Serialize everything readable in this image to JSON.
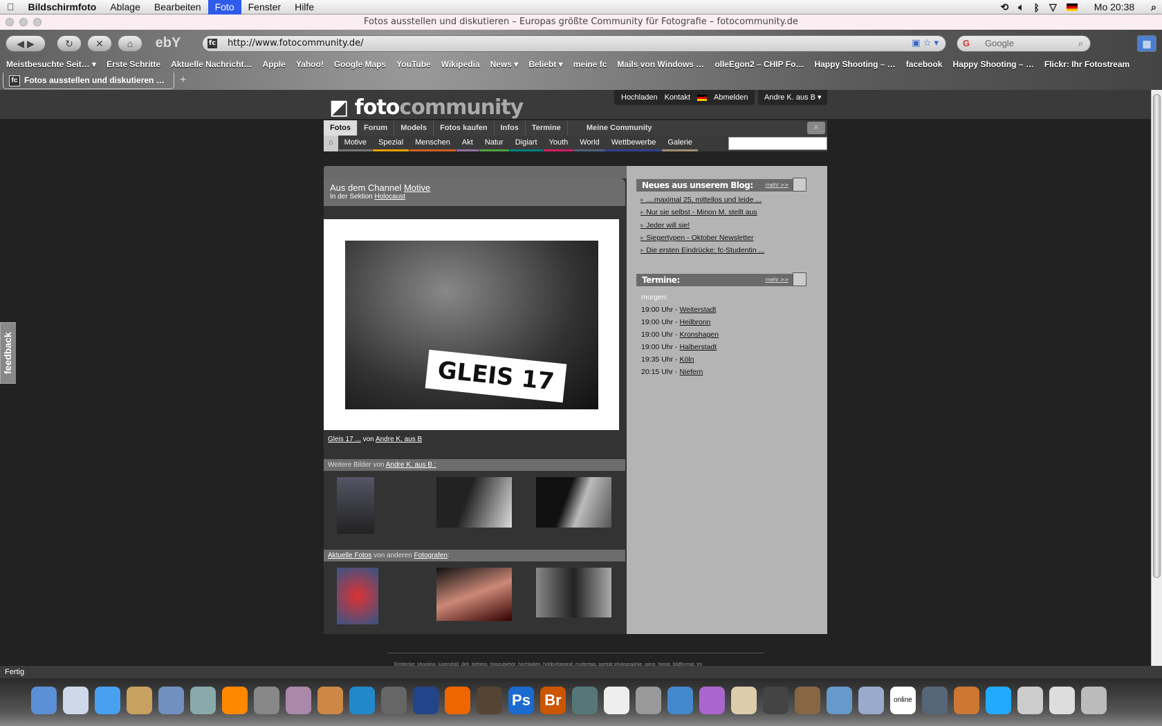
{
  "menubar": {
    "app": "Bildschirmfoto",
    "items": [
      "Ablage",
      "Bearbeiten",
      "Foto",
      "Fenster",
      "Hilfe"
    ],
    "active": "Foto",
    "clock": "Mo 20:38"
  },
  "window": {
    "title": "Fotos ausstellen und diskutieren – Europas größte Community für Fotografie – fotocommunity.de"
  },
  "toolbar": {
    "url": "http://www.fotocommunity.de/",
    "search_placeholder": "Google"
  },
  "bookmarks": [
    "Meistbesuchte Seit… ▾",
    "Erste Schritte",
    "Aktuelle Nachricht…",
    "Apple",
    "Yahoo!",
    "Google Maps",
    "YouTube",
    "Wikipedia",
    "News ▾",
    "Beliebt ▾",
    "meine fc",
    "Mails von Windows …",
    "olleEgon2 – CHIP Fo…",
    "Happy Shooting – …",
    "facebook",
    "Happy Shooting – …",
    "Flickr: Ihr Fotostream"
  ],
  "tab": {
    "label": "Fotos ausstellen und diskutieren …"
  },
  "site": {
    "logo": {
      "a": "foto",
      "b": "community"
    },
    "toplinks": [
      "Hochladen",
      "Kontakt",
      "Abmelden"
    ],
    "user": "Andre K. aus B ▾",
    "nav": [
      "Fotos",
      "Forum",
      "Models",
      "Fotos kaufen",
      "Infos",
      "Termine",
      "Meine Community"
    ],
    "subnav": [
      {
        "label": "Motive",
        "color": "#777777"
      },
      {
        "label": "Spezial",
        "color": "#e8a000"
      },
      {
        "label": "Menschen",
        "color": "#d06020"
      },
      {
        "label": "Akt",
        "color": "#9070a0"
      },
      {
        "label": "Natur",
        "color": "#50a040"
      },
      {
        "label": "Digiart",
        "color": "#008080"
      },
      {
        "label": "Youth",
        "color": "#d02060"
      },
      {
        "label": "World",
        "color": "#506080"
      },
      {
        "label": "Wettbewerbe",
        "color": "#304090"
      },
      {
        "label": "Galerie",
        "color": "#a09070"
      }
    ]
  },
  "channel": {
    "prefix": "Aus dem Channel ",
    "name": "Motive",
    "section_prefix": "In der Sektion ",
    "section": "Holocaust",
    "photo_sign": "GLEIS 17",
    "photo_title": "Gleis 17 ...",
    "von": " von ",
    "author": "Andre K. aus B"
  },
  "more": {
    "prefix": "Weitere Bilder von ",
    "author": "Andre K. aus B :"
  },
  "recent": {
    "link1": "Aktuelle Fotos",
    "mid": " von anderen ",
    "link2": "Fotografen",
    "suffix": ":"
  },
  "blog": {
    "title": "Neues aus unserem Blog:",
    "mehr": "mehr >>",
    "items": [
      "....maximal 25, mittellos und leide ...",
      "Nur sie selbst - Minon M. stellt aus",
      "Jeder will sie!",
      "Siegertypen - Oktober Newsletter",
      "Die ersten Eindrücke: fc-Studentin ..."
    ]
  },
  "termine": {
    "title": "Termine:",
    "mehr": "mehr >>",
    "day": "morgen:",
    "items": [
      {
        "time": "19:00 Uhr - ",
        "place": "Weiterstadt"
      },
      {
        "time": "19:00 Uhr - ",
        "place": "Heilbronn"
      },
      {
        "time": "19:00 Uhr - ",
        "place": "Kronshagen"
      },
      {
        "time": "19:00 Uhr - ",
        "place": "Halberstadt"
      },
      {
        "time": "19:35 Uhr - ",
        "place": "Köln"
      },
      {
        "time": "20:15 Uhr - ",
        "place": "Niefern"
      }
    ]
  },
  "feedback": "feedback",
  "footer": "Entdecke: shooting, jugendstil, delr, tiefotos, fotozubehör, hochladen, hobbyfotograf, muttertag, porträt photographie, gimp, heirat, bildformat, tm",
  "status": "Fertig",
  "dock": {
    "ps": "Ps",
    "br": "Br",
    "online": "online"
  }
}
